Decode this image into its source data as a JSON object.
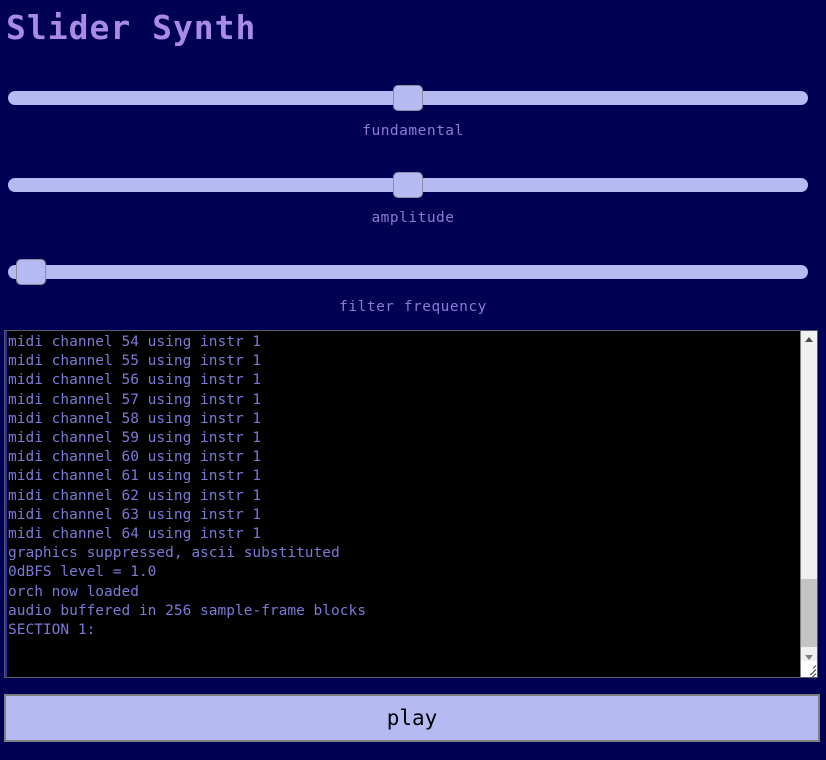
{
  "app": {
    "title": "Slider Synth",
    "title_color": "#a98ae8",
    "background_color": "#000055",
    "accent_color": "#b6baf2"
  },
  "sliders": [
    {
      "name": "fundamental",
      "label": "fundamental",
      "value_percent": 50,
      "min": 0,
      "max": 100
    },
    {
      "name": "amplitude",
      "label": "amplitude",
      "value_percent": 50,
      "min": 0,
      "max": 100
    },
    {
      "name": "filter-frequency",
      "label": "filter frequency",
      "value_percent": 1,
      "min": 0,
      "max": 100
    }
  ],
  "console": {
    "text_color": "#7a7ad6",
    "background_color": "#000000",
    "lines": [
      "midi channel 54 using instr 1",
      "midi channel 55 using instr 1",
      "midi channel 56 using instr 1",
      "midi channel 57 using instr 1",
      "midi channel 58 using instr 1",
      "midi channel 59 using instr 1",
      "midi channel 60 using instr 1",
      "midi channel 61 using instr 1",
      "midi channel 62 using instr 1",
      "midi channel 63 using instr 1",
      "midi channel 64 using instr 1",
      "graphics suppressed, ascii substituted",
      "0dBFS level = 1.0",
      "orch now loaded",
      "audio buffered in 256 sample-frame blocks",
      "SECTION 1:"
    ],
    "scrollbar": {
      "up_arrow": "chevron-up-icon",
      "down_arrow": "chevron-down-icon",
      "resize_grip": "resize-grip-icon"
    }
  },
  "play_button": {
    "label": "play"
  }
}
